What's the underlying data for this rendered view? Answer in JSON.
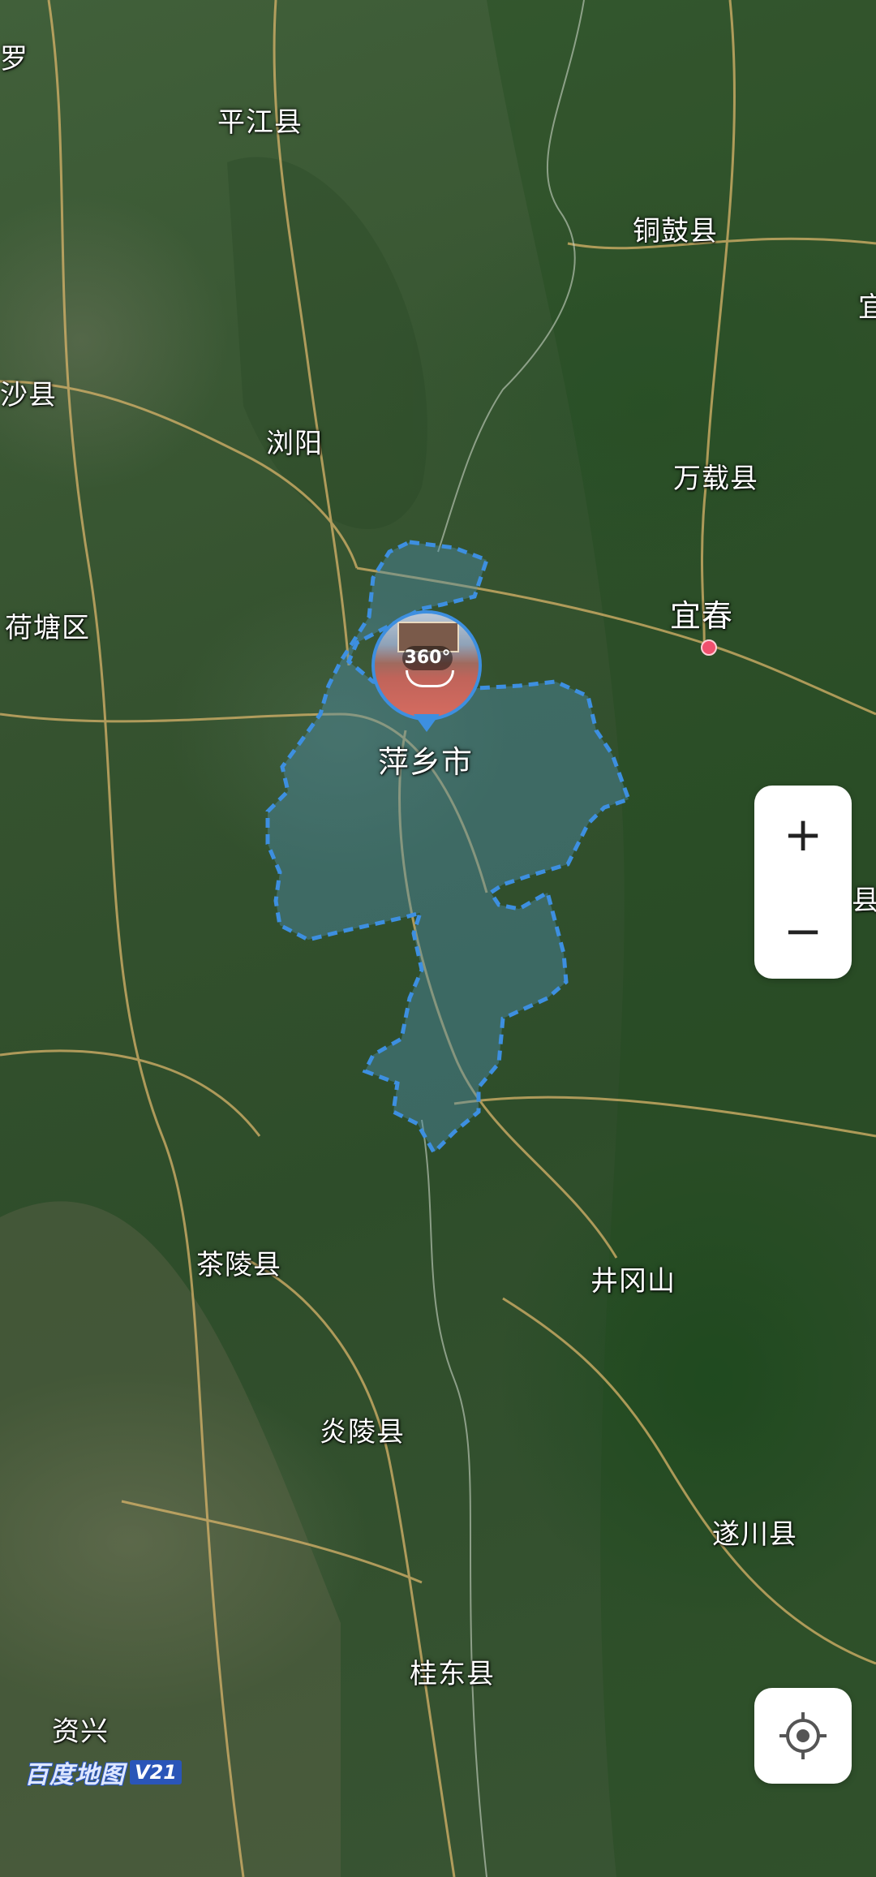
{
  "map": {
    "type": "satellite",
    "highlighted_region": "萍乡市",
    "places": [
      {
        "id": "luo",
        "label": "罗"
      },
      {
        "id": "pingjiang",
        "label": "平江县"
      },
      {
        "id": "tonggu",
        "label": "铜鼓县"
      },
      {
        "id": "yi",
        "label": "宜"
      },
      {
        "id": "changsha",
        "label": "沙县"
      },
      {
        "id": "liuyang",
        "label": "浏阳"
      },
      {
        "id": "wanzai",
        "label": "万载县"
      },
      {
        "id": "hetang",
        "label": "荷塘区"
      },
      {
        "id": "yichun",
        "label": "宜春"
      },
      {
        "id": "pingxiang",
        "label": "萍乡市"
      },
      {
        "id": "chaling",
        "label": "茶陵县"
      },
      {
        "id": "jinggangshan",
        "label": "井冈山"
      },
      {
        "id": "yanling",
        "label": "炎陵县"
      },
      {
        "id": "suichuan",
        "label": "遂川县"
      },
      {
        "id": "guidong",
        "label": "桂东县"
      },
      {
        "id": "zixing",
        "label": "资兴"
      },
      {
        "id": "edge",
        "label": "县"
      }
    ]
  },
  "marker": {
    "badge": "360°",
    "icon": "panorama-photo-icon"
  },
  "controls": {
    "zoom_in_label": "+",
    "zoom_out_label": "−",
    "locate_icon": "locate-icon"
  },
  "logo": {
    "text": "百度地图",
    "version": "V21"
  },
  "colors": {
    "boundary": "#3d8fe0",
    "region_fill": "#4f8fb0",
    "road": "#d9b46a",
    "city_dot": "#f0506e"
  }
}
